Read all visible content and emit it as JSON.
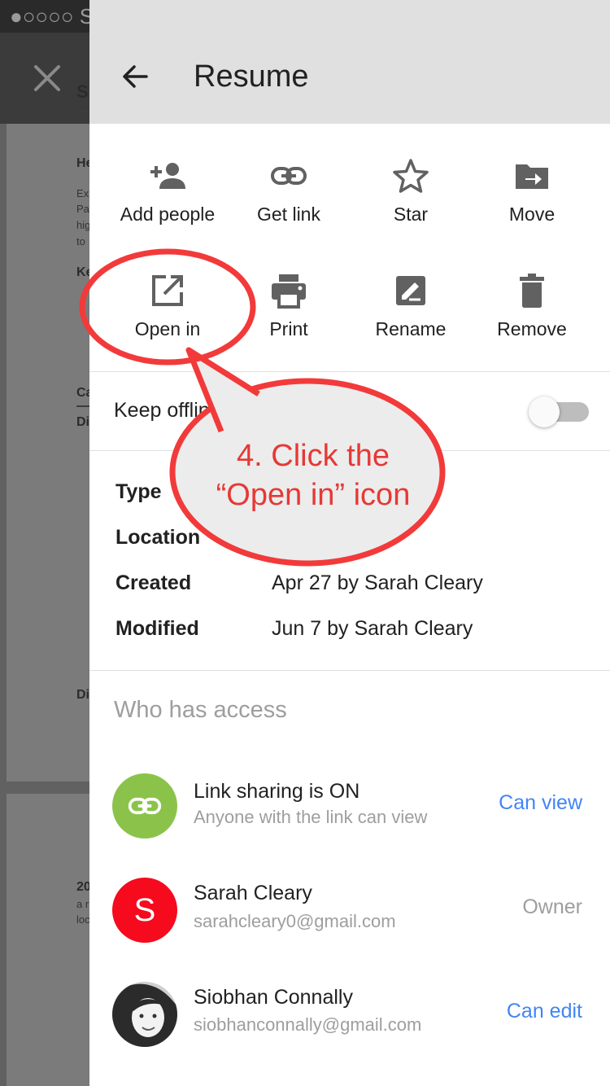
{
  "background": {
    "status_text": "●○○○○ Sp",
    "doc_fragments": [
      "S",
      "He",
      "Ke",
      "Ca",
      "Di",
      "Di",
      "20"
    ],
    "doc_small_lines": [
      "Ex",
      "Pa",
      "hig",
      "to",
      "a r",
      "loc"
    ]
  },
  "header": {
    "title": "Resume"
  },
  "actions": [
    {
      "label": "Add people",
      "icon": "add-person-icon"
    },
    {
      "label": "Get link",
      "icon": "link-icon"
    },
    {
      "label": "Star",
      "icon": "star-icon"
    },
    {
      "label": "Move",
      "icon": "move-folder-icon"
    },
    {
      "label": "Open in",
      "icon": "open-in-icon"
    },
    {
      "label": "Print",
      "icon": "print-icon"
    },
    {
      "label": "Rename",
      "icon": "rename-icon"
    },
    {
      "label": "Remove",
      "icon": "trash-icon"
    }
  ],
  "offline": {
    "label": "Keep offline",
    "enabled": false
  },
  "details": [
    {
      "key": "Type",
      "value": ""
    },
    {
      "key": "Location",
      "value": ""
    },
    {
      "key": "Created",
      "value": "Apr 27 by Sarah Cleary"
    },
    {
      "key": "Modified",
      "value": "Jun 7 by Sarah Cleary"
    }
  ],
  "access": {
    "title": "Who has access",
    "entries": [
      {
        "name": "Link sharing is ON",
        "sub": "Anyone with the link can view",
        "role": "Can view",
        "role_color": "#4285f4",
        "avatar_color": "#8bc34a"
      },
      {
        "name": "Sarah Cleary",
        "sub": "sarahcleary0@gmail.com",
        "role": "Owner",
        "role_color": "#9e9e9e",
        "avatar_color": "#f50a1e",
        "initial": "S"
      },
      {
        "name": "Siobhan Connally",
        "sub": "siobhanconnally@gmail.com",
        "role": "Can edit",
        "role_color": "#4285f4"
      }
    ]
  },
  "callout": {
    "line1": "4. Click the",
    "line2": "“Open in” icon",
    "color": "#f23a3a"
  }
}
